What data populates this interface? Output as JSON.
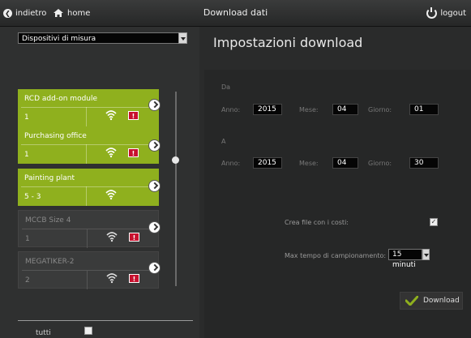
{
  "topbar": {
    "back_label": "indietro",
    "home_label": "home",
    "title": "Download dati",
    "logout_label": "logout"
  },
  "left": {
    "select_value": "Dispositivi di misura",
    "devices": [
      {
        "name": "RCD add-on module",
        "value": "1",
        "state": "active",
        "alarm": true
      },
      {
        "name": "Purchasing office",
        "value": "1",
        "state": "active",
        "alarm": true
      },
      {
        "name": "Painting plant",
        "value": "5 - 3",
        "state": "active",
        "alarm": false
      },
      {
        "name": "MCCB Size 4",
        "value": "1",
        "state": "inactive",
        "alarm": true
      },
      {
        "name": "MEGATIKER-2",
        "value": "2",
        "state": "inactive",
        "alarm": true
      }
    ],
    "alarm_symbol": "!",
    "select_all_label": "tutti",
    "select_all_checked": false
  },
  "right": {
    "title": "Impostazioni download",
    "from": {
      "section_label": "Da",
      "year_label": "Anno:",
      "year": "2015",
      "month_label": "Mese:",
      "month": "04",
      "day_label": "Giorno:",
      "day": "01"
    },
    "to": {
      "section_label": "A",
      "year_label": "Anno:",
      "year": "2015",
      "month_label": "Mese:",
      "month": "04",
      "day_label": "Giorno:",
      "day": "30"
    },
    "create_cost_file_label": "Crea file con i costi:",
    "create_cost_file_checked": true,
    "max_sampling_label": "Max tempo di campionamento:",
    "max_sampling_value": "15 minuti",
    "download_label": "Download"
  },
  "colors": {
    "active_device": "#8fb01e",
    "alarm": "#c8102e",
    "download_check": "#8fb01e"
  }
}
